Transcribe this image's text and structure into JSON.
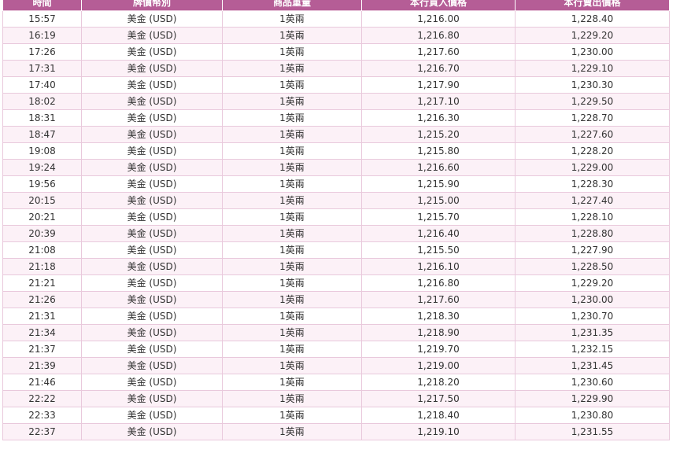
{
  "table": {
    "headers": [
      "時間",
      "牌價幣別",
      "商品重量",
      "本行買入價格",
      "本行賣出價格"
    ],
    "rows": [
      {
        "time": "15:57",
        "currency": "美金 (USD)",
        "weight": "1英兩",
        "buy": "1,216.00",
        "sell": "1,228.40"
      },
      {
        "time": "16:19",
        "currency": "美金 (USD)",
        "weight": "1英兩",
        "buy": "1,216.80",
        "sell": "1,229.20"
      },
      {
        "time": "17:26",
        "currency": "美金 (USD)",
        "weight": "1英兩",
        "buy": "1,217.60",
        "sell": "1,230.00"
      },
      {
        "time": "17:31",
        "currency": "美金 (USD)",
        "weight": "1英兩",
        "buy": "1,216.70",
        "sell": "1,229.10"
      },
      {
        "time": "17:40",
        "currency": "美金 (USD)",
        "weight": "1英兩",
        "buy": "1,217.90",
        "sell": "1,230.30"
      },
      {
        "time": "18:02",
        "currency": "美金 (USD)",
        "weight": "1英兩",
        "buy": "1,217.10",
        "sell": "1,229.50"
      },
      {
        "time": "18:31",
        "currency": "美金 (USD)",
        "weight": "1英兩",
        "buy": "1,216.30",
        "sell": "1,228.70"
      },
      {
        "time": "18:47",
        "currency": "美金 (USD)",
        "weight": "1英兩",
        "buy": "1,215.20",
        "sell": "1,227.60"
      },
      {
        "time": "19:08",
        "currency": "美金 (USD)",
        "weight": "1英兩",
        "buy": "1,215.80",
        "sell": "1,228.20"
      },
      {
        "time": "19:24",
        "currency": "美金 (USD)",
        "weight": "1英兩",
        "buy": "1,216.60",
        "sell": "1,229.00"
      },
      {
        "time": "19:56",
        "currency": "美金 (USD)",
        "weight": "1英兩",
        "buy": "1,215.90",
        "sell": "1,228.30"
      },
      {
        "time": "20:15",
        "currency": "美金 (USD)",
        "weight": "1英兩",
        "buy": "1,215.00",
        "sell": "1,227.40"
      },
      {
        "time": "20:21",
        "currency": "美金 (USD)",
        "weight": "1英兩",
        "buy": "1,215.70",
        "sell": "1,228.10"
      },
      {
        "time": "20:39",
        "currency": "美金 (USD)",
        "weight": "1英兩",
        "buy": "1,216.40",
        "sell": "1,228.80"
      },
      {
        "time": "21:08",
        "currency": "美金 (USD)",
        "weight": "1英兩",
        "buy": "1,215.50",
        "sell": "1,227.90"
      },
      {
        "time": "21:18",
        "currency": "美金 (USD)",
        "weight": "1英兩",
        "buy": "1,216.10",
        "sell": "1,228.50"
      },
      {
        "time": "21:21",
        "currency": "美金 (USD)",
        "weight": "1英兩",
        "buy": "1,216.80",
        "sell": "1,229.20"
      },
      {
        "time": "21:26",
        "currency": "美金 (USD)",
        "weight": "1英兩",
        "buy": "1,217.60",
        "sell": "1,230.00"
      },
      {
        "time": "21:31",
        "currency": "美金 (USD)",
        "weight": "1英兩",
        "buy": "1,218.30",
        "sell": "1,230.70"
      },
      {
        "time": "21:34",
        "currency": "美金 (USD)",
        "weight": "1英兩",
        "buy": "1,218.90",
        "sell": "1,231.35"
      },
      {
        "time": "21:37",
        "currency": "美金 (USD)",
        "weight": "1英兩",
        "buy": "1,219.70",
        "sell": "1,232.15"
      },
      {
        "time": "21:39",
        "currency": "美金 (USD)",
        "weight": "1英兩",
        "buy": "1,219.00",
        "sell": "1,231.45"
      },
      {
        "time": "21:46",
        "currency": "美金 (USD)",
        "weight": "1英兩",
        "buy": "1,218.20",
        "sell": "1,230.60"
      },
      {
        "time": "22:22",
        "currency": "美金 (USD)",
        "weight": "1英兩",
        "buy": "1,217.50",
        "sell": "1,229.90"
      },
      {
        "time": "22:33",
        "currency": "美金 (USD)",
        "weight": "1英兩",
        "buy": "1,218.40",
        "sell": "1,230.80"
      },
      {
        "time": "22:37",
        "currency": "美金 (USD)",
        "weight": "1英兩",
        "buy": "1,219.10",
        "sell": "1,231.55"
      }
    ]
  },
  "colors": {
    "header_bg": "#b55d96",
    "header_text": "#ffffff",
    "row_alt_bg": "#fcf1f7",
    "grid": "#e9c9dc",
    "cell_text": "#333333"
  }
}
